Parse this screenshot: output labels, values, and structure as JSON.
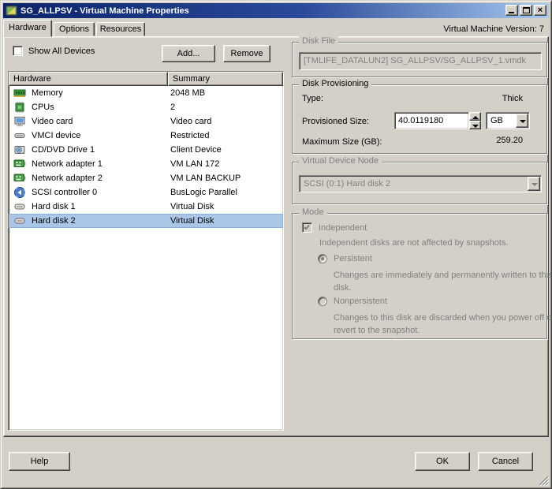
{
  "window": {
    "title": "SG_ALLPSV - Virtual Machine Properties"
  },
  "header": {
    "version_label": "Virtual Machine Version: 7"
  },
  "tabs": [
    {
      "label": "Hardware",
      "active": true
    },
    {
      "label": "Options",
      "active": false
    },
    {
      "label": "Resources",
      "active": false
    }
  ],
  "toolbar": {
    "show_all_devices_label": "Show All Devices",
    "show_all_devices_checked": false,
    "add_label": "Add...",
    "remove_label": "Remove"
  },
  "hardware_table": {
    "columns": [
      "Hardware",
      "Summary"
    ],
    "rows": [
      {
        "icon": "memory-icon",
        "label": "Memory",
        "summary": "2048 MB",
        "selected": false
      },
      {
        "icon": "cpu-icon",
        "label": "CPUs",
        "summary": "2",
        "selected": false
      },
      {
        "icon": "video-card-icon",
        "label": "Video card",
        "summary": "Video card",
        "selected": false
      },
      {
        "icon": "vmci-device-icon",
        "label": "VMCI device",
        "summary": "Restricted",
        "selected": false
      },
      {
        "icon": "cd-dvd-drive-icon",
        "label": "CD/DVD Drive 1",
        "summary": "Client Device",
        "selected": false
      },
      {
        "icon": "network-adapter-icon",
        "label": "Network adapter 1",
        "summary": "VM LAN 172",
        "selected": false
      },
      {
        "icon": "network-adapter-icon",
        "label": "Network adapter 2",
        "summary": "VM LAN BACKUP",
        "selected": false
      },
      {
        "icon": "scsi-controller-icon",
        "label": "SCSI controller 0",
        "summary": "BusLogic Parallel",
        "selected": false
      },
      {
        "icon": "hard-disk-icon",
        "label": "Hard disk 1",
        "summary": "Virtual Disk",
        "selected": false
      },
      {
        "icon": "hard-disk-icon",
        "label": "Hard disk 2",
        "summary": "Virtual Disk",
        "selected": true
      }
    ]
  },
  "disk_file": {
    "group_label": "Disk File",
    "file_value": "[TMLIFE_DATALUN2] SG_ALLPSV/SG_ALLPSV_1.vmdk"
  },
  "disk_provisioning": {
    "group_label": "Disk Provisioning",
    "type_label": "Type:",
    "type_value": "Thick",
    "provisioned_size_label": "Provisioned Size:",
    "provisioned_size_value": "40.0119180",
    "unit_value": "GB",
    "maximum_size_label": "Maximum Size (GB):",
    "maximum_size_value": "259.20"
  },
  "virtual_device_node": {
    "group_label": "Virtual Device Node",
    "selected_value": "SCSI (0:1) Hard disk 2"
  },
  "mode": {
    "group_label": "Mode",
    "independent_label": "Independent",
    "independent_checked": true,
    "independent_desc": "Independent disks are not affected by snapshots.",
    "persistent_label": "Persistent",
    "persistent_selected": true,
    "persistent_desc": "Changes are immediately and permanently written to the disk.",
    "nonpersistent_label": "Nonpersistent",
    "nonpersistent_selected": false,
    "nonpersistent_desc": "Changes to this disk are discarded when you power off or revert to the snapshot."
  },
  "footer": {
    "help_label": "Help",
    "ok_label": "OK",
    "cancel_label": "Cancel"
  },
  "colors": {
    "dialog_bg": "#d4d0c8",
    "titlebar_start": "#0a246a",
    "titlebar_end": "#a6caf0",
    "selection_bg": "#aac6e6",
    "disabled_text": "#808080",
    "list_bg": "#ffffff"
  }
}
